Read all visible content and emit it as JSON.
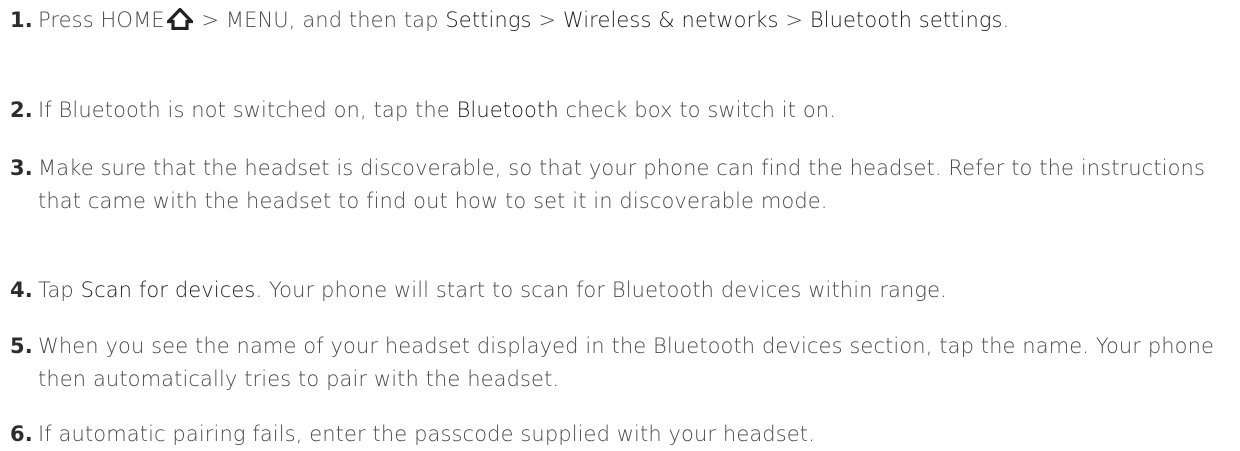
{
  "steps": [
    {
      "number": "1.",
      "p1": "Press HOME",
      "p2": " > MENU, and then tap ",
      "p3": "Settings",
      "p4": " > ",
      "p5": "Wireless & networks",
      "p6": " > ",
      "p7": "Bluetooth settings",
      "p8": ".",
      "icon": "home-icon"
    },
    {
      "number": "2.",
      "p1": "If Bluetooth is not switched on, tap the ",
      "p2": "Bluetooth",
      "p3": " check box to switch it on."
    },
    {
      "number": "3.",
      "p1": "Make sure that the headset is discoverable, so that your phone can find the headset. Refer to the instructions that came with the headset to find out how to set it in discoverable mode."
    },
    {
      "number": "4.",
      "p1": "Tap ",
      "p2": "Scan for devices",
      "p3": ". Your phone will start to scan for Bluetooth devices within range."
    },
    {
      "number": "5.",
      "p1": "When you see the name of your headset displayed in the Bluetooth devices section, tap the name. Your phone then automatically tries to pair with the headset."
    },
    {
      "number": "6.",
      "p1": "If automatic pairing fails, enter the passcode supplied with your headset."
    }
  ]
}
